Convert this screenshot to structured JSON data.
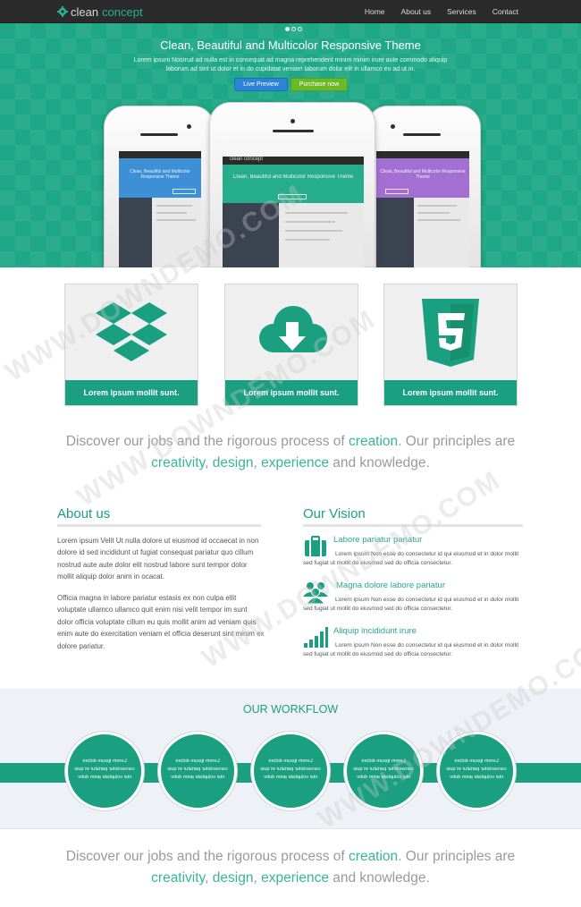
{
  "brand": {
    "part1": "clean",
    "part2": "concept"
  },
  "nav": {
    "items": [
      "Home",
      "About us",
      "Services",
      "Contact"
    ]
  },
  "hero": {
    "title": "Clean, Beautiful and Multicolor Responsive Theme",
    "text": "Lorem ipsum Nostrud ad nulla est in consequat ad magna reprehenderit minim minim irure aute commodo aliquip laborum ad sint ut dolor et in do cupidatat veniam laborum dolor elit in ullamco eu ad ut in.",
    "live_preview": "Live Preview",
    "purchase": "Purchase now",
    "phone_screen": {
      "brand": "clean concept",
      "title": "Clean, Beautiful and Multicolor Responsive Theme"
    }
  },
  "cards": [
    {
      "icon": "dropbox-icon",
      "label": "Lorem ipsum mollit sunt."
    },
    {
      "icon": "cloud-download-icon",
      "label": "Lorem ipsum mollit sunt."
    },
    {
      "icon": "html5-icon",
      "label": "Lorem ipsum mollit sunt."
    }
  ],
  "tagline": {
    "p1": "Discover our jobs and the rigorous process of ",
    "h1": "creation",
    "p2": ". Our principles are ",
    "h2": "creativity",
    "p3": ", ",
    "h3": "design",
    "p4": ", ",
    "h4": "experience",
    "p5": " and knowledge."
  },
  "about": {
    "title": "About us",
    "p1": "Lorem ipsum Velit Ut nulla dolore ut eiusmod id occaecat in non dolore id sed incididunt ut fugiat consequat pariatur quo cillum nostrud aute aute dolor elit nostrud labore sunt tempor dolor mollit aliquip dolor anim in ocacat.",
    "p2": "Officia magna in labore pariatur estasis ex non culpa ellit voluptate ullamco ullamco quit enim nisi velit tempor im sunt dolor officia voluptate cillum eu quis mollit anim ad veniam quis enim aute do exercitation veniam et officia deserunt sint minim ex dolore pariatur."
  },
  "vision": {
    "title": "Our Vision",
    "items": [
      {
        "icon": "briefcase-icon",
        "heading": "Labore pariatur pariatur",
        "text": "Lorem ipsum Non esse do consectetur id qui eiusmod et in dolor mollit sed fugiat ut mollit do eiusmod sed do officia consectetur."
      },
      {
        "icon": "users-icon",
        "heading": "Magna dolore labore pariatur",
        "text": "Lorem ipsum Non esse do consectetur id qui eiusmod et in dolor mollit sed fugiat ut mollit do eiusmod sed do officia consectetur."
      },
      {
        "icon": "signal-bars-icon",
        "heading": "Aliquip incididunt irure",
        "text": "Lorem ipsum Non esse do consectetur id qui eiusmod et in dolor mollit sed fugiat ut mollit do eiusmod sed do officia consectetur."
      }
    ]
  },
  "workflow": {
    "title": "OUR WORKFLOW",
    "steps": [
      "Lorem ipsum dolore consectetur pariatur et quis nisi voluptate anim dolor",
      "Lorem ipsum dolore consectetur pariatur et quis nisi voluptate anim dolor",
      "Lorem ipsum dolore consectetur pariatur et quis nisi voluptate anim dolor",
      "Lorem ipsum dolore consectetur pariatur et quis nisi voluptate anim dolor",
      "Lorem ipsum dolore consectetur pariatur et quis nisi voluptate anim dolor"
    ]
  },
  "watermark": "WWW.DOWNDEMO.COM",
  "colors": {
    "accent": "#1a9f80",
    "hero": "#1fa887",
    "navbar": "#2b2b2b",
    "live_button": "#2c84d4",
    "purchase_button": "#6bb92b",
    "workflow_bg": "#eef1f7"
  }
}
